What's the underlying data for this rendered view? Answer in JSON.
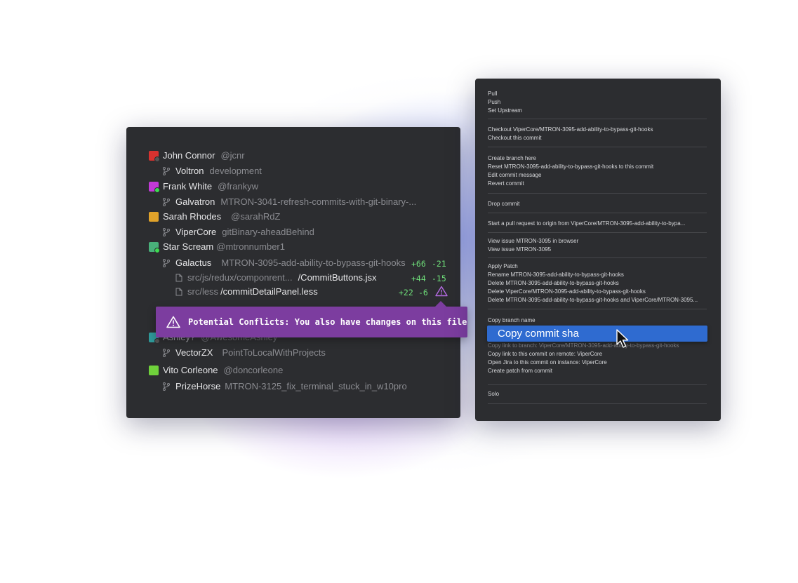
{
  "left_panel": {
    "users": [
      {
        "name": "John Connor",
        "handle": "@jcnr",
        "avatar_color": "#d8322f",
        "status_color": "#555",
        "branch_repo": "Voltron",
        "branch_name": "development"
      },
      {
        "name": "Frank White",
        "handle": "@frankyw",
        "avatar_color": "#c23ad6",
        "status_color": "#3ddc52",
        "branch_repo": "Galvatron",
        "branch_name": "MTRON-3041-refresh-commits-with-git-binary-..."
      },
      {
        "name": "Sarah Rhodes",
        "handle": "@sarahRdZ",
        "avatar_color": "#e0a22a",
        "status_color": "",
        "branch_repo": "ViperCore",
        "branch_name": "gitBinary-aheadBehind"
      },
      {
        "name": "Star Scream",
        "handle": "@mtronnumber1",
        "avatar_color": "#49b07a",
        "status_color": "#3ddc52",
        "branch_repo": "Galactus",
        "branch_name": "MTRON-3095-add-ability-to-bypass-git-hooks"
      },
      {
        "name": "Ashley?",
        "handle": "@AwesomeAshley",
        "avatar_color": "#2f9a9a",
        "status_color": "#555",
        "branch_repo": "VectorZX",
        "branch_name": "PointToLocalWithProjects"
      },
      {
        "name": "Vito Corleone",
        "handle": "@doncorleone",
        "avatar_color": "#6fd13b",
        "status_color": "",
        "branch_repo": "PrizeHorse",
        "branch_name": "MTRON-3125_fix_terminal_stuck_in_w10pro"
      }
    ],
    "branch_diff": {
      "add": "+66",
      "del": "-21"
    },
    "files": [
      {
        "dir": "src/js/redux/componrent...",
        "file": "/CommitButtons.jsx",
        "add": "+44",
        "del": "-15"
      },
      {
        "dir": "src/less",
        "file": "/commitDetailPanel.less",
        "add": "+22",
        "del": "-6"
      }
    ],
    "conflict_icon": "warning-triangle-icon"
  },
  "tooltip": {
    "text": "Potential Conflicts: You also have changes on this file",
    "icon": "warning-triangle-icon",
    "color": "#7c3d9f"
  },
  "context_menu": {
    "items": [
      "Pull",
      "Push",
      "Set Upstream",
      "Checkout ViperCore/MTRON-3095-add-ability-to-bypass-git-hooks",
      "Checkout this commit",
      "Create branch here",
      "Reset MTRON-3095-add-ability-to-bypass-git-hooks to this commit",
      "Edit commit message",
      "Revert commit",
      "Drop commit",
      "Start a pull request to origin from ViperCore/MTRON-3095-add-ability-to-bypa...",
      "View issue MTRON-3095 in browser",
      "View issue MTRON-3095",
      "Apply Patch",
      "Rename MTRON-3095-add-ability-to-bypass-git-hooks",
      "Delete MTRON-3095-add-ability-to-bypass-git-hooks",
      "Delete ViperCore/MTRON-3095-add-ability-to-bypass-git-hooks",
      "Delete MTRON-3095-add-ability-to-bypass-git-hooks and ViperCore/MTRON-3095...",
      "Copy branch name",
      "Copy link to branch:  ViperCore/MTRON-3095-add-ability-to-bypass-git-hooks",
      "Copy link to this commit on remote:  ViperCore",
      "Open Jira to this commit on instance:  ViperCore",
      "Create patch from commit",
      "Solo"
    ],
    "highlighted": "Copy commit sha",
    "highlight_color": "#2f6bd0",
    "cursor_icon": "mouse-pointer-icon"
  }
}
